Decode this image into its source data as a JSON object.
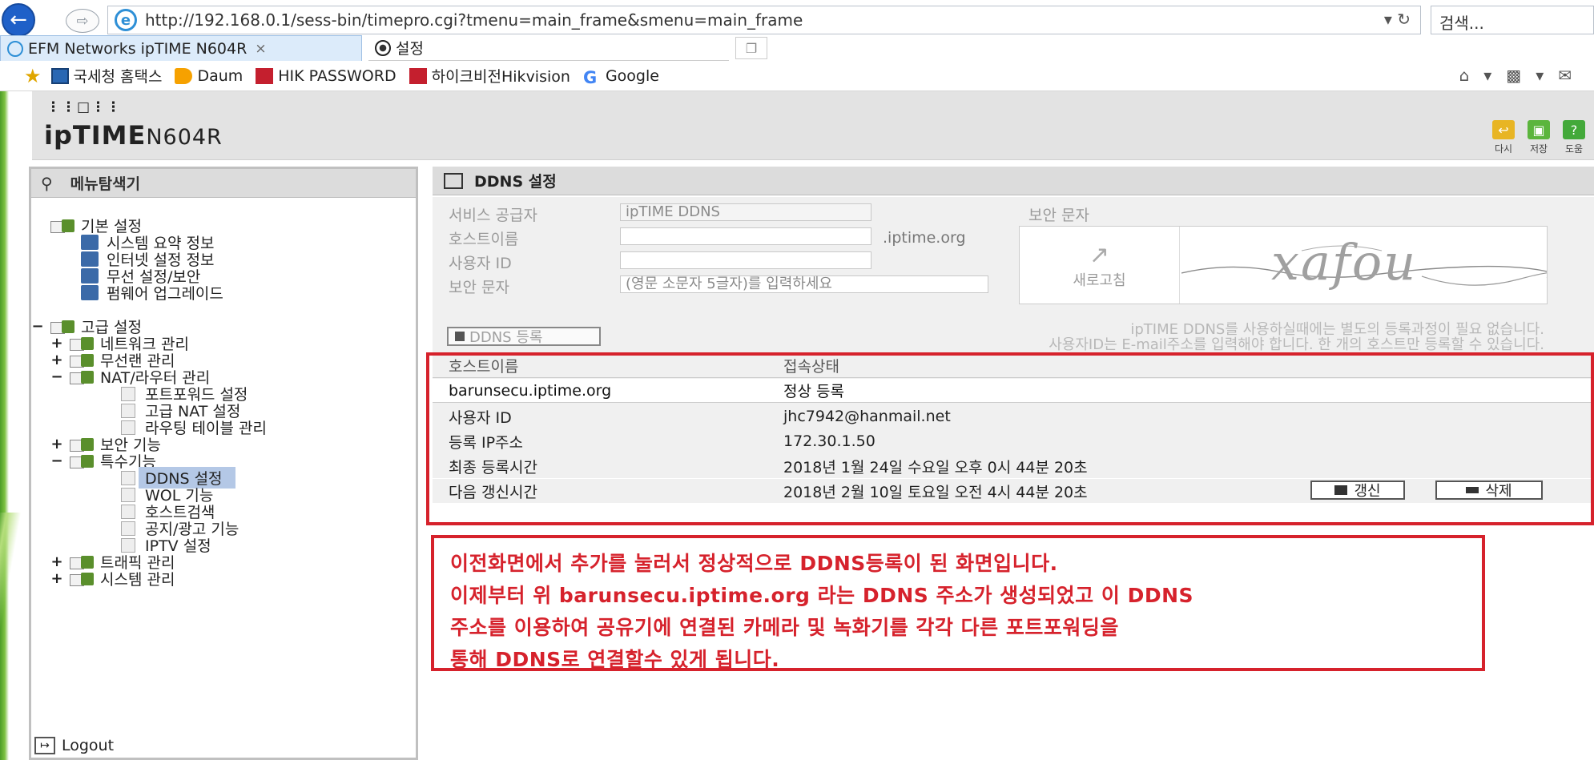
{
  "browser": {
    "url": "http://192.168.0.1/sess-bin/timepro.cgi?tmenu=main_frame&smenu=main_frame",
    "search_placeholder": "검색...",
    "tabs": [
      {
        "label": "EFM Networks ipTIME N604R",
        "close": "×"
      },
      {
        "label": "설정"
      }
    ],
    "favorites": [
      "국세청 홈택스",
      "Daum",
      "HIK PASSWORD",
      "하이크비전Hikvision",
      "Google"
    ]
  },
  "router": {
    "logo": "ipTIME",
    "model": "N604R",
    "header_buttons": [
      "다시",
      "저장",
      "도움"
    ]
  },
  "menu": {
    "title": "메뉴탐색기",
    "basic": {
      "label": "기본 설정",
      "items": [
        "시스템 요약 정보",
        "인터넷 설정 정보",
        "무선 설정/보안",
        "펌웨어 업그레이드"
      ]
    },
    "advanced": {
      "label": "고급 설정",
      "network": "네트워크 관리",
      "wireless": "무선랜 관리",
      "nat": "NAT/라우터 관리",
      "nat_items": [
        "포트포워드 설정",
        "고급 NAT 설정",
        "라우팅 테이블 관리"
      ],
      "security": "보안 기능",
      "special": "특수기능",
      "special_items": [
        "DDNS 설정",
        "WOL 기능",
        "호스트검색",
        "공지/광고 기능",
        "IPTV 설정"
      ],
      "traffic": "트래픽 관리",
      "system": "시스템 관리"
    },
    "logout": "Logout"
  },
  "ddns": {
    "title": "DDNS 설정",
    "form": {
      "provider_label": "서비스 공급자",
      "provider_value": "ipTIME DDNS",
      "hostname_label": "호스트이름",
      "hostname_suffix": ".iptime.org",
      "userid_label": "사용자 ID",
      "captcha_label": "보안 문자",
      "captcha_placeholder": "(영문 소문자 5글자)를 입력하세요",
      "captcha_title": "보안 문자",
      "refresh_label": "새로고침",
      "captcha_text": "xafou"
    },
    "register_button": "DDNS 등록",
    "notice_line1": "ipTIME DDNS를 사용하실때에는 별도의 등록과정이 필요 없습니다.",
    "notice_line2": "사용자ID는 E-mail주소를 입력해야 합니다. 한 개의 호스트만 등록할 수 있습니다.",
    "status": {
      "col_host": "호스트이름",
      "col_state": "접속상태",
      "host": "barunsecu.iptime.org",
      "state": "정상 등록",
      "rows": [
        {
          "label": "사용자 ID",
          "value": "jhc7942@hanmail.net"
        },
        {
          "label": "등록 IP주소",
          "value": "172.30.1.50"
        },
        {
          "label": "최종 등록시간",
          "value": "2018년 1월 24일 수요일 오후 0시 44분 20초"
        },
        {
          "label": "다음 갱신시간",
          "value": "2018년 2월 10일 토요일 오전 4시 44분 20초"
        }
      ],
      "renew_button": "갱신",
      "delete_button": "삭제"
    }
  },
  "annotation": {
    "lines": [
      "이전화면에서 추가를 눌러서 정상적으로 DDNS등록이 된 화면입니다.",
      "이제부터 위 barunsecu.iptime.org 라는 DDNS 주소가 생성되었고 이 DDNS",
      "주소를 이용하여 공유기에 연결된 카메라 및 녹화기를 각각 다른 포트포워딩을",
      "통해 DDNS로 연결할수 있게 됩니다."
    ]
  },
  "colors": {
    "accent_red": "#d6222c",
    "selected_menu": "#b4c8e6",
    "ie_blue": "#1f60c8"
  }
}
